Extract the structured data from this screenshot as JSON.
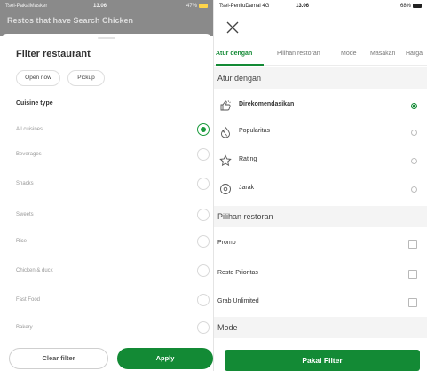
{
  "left": {
    "status": {
      "carrier": "Tsel-PakaiMasker",
      "time": "13.06",
      "battery": "47%"
    },
    "behind_title": "Restos that have Search Chicken",
    "title": "Filter restaurant",
    "chips": [
      "Open now",
      "Pickup"
    ],
    "section": "Cuisine type",
    "options": [
      {
        "label": "All cuisines",
        "selected": true
      },
      {
        "label": "Beverages",
        "selected": false
      },
      {
        "label": "Snacks",
        "selected": false
      },
      {
        "label": "Sweets",
        "selected": false
      },
      {
        "label": "Rice",
        "selected": false
      },
      {
        "label": "Chicken & duck",
        "selected": false
      },
      {
        "label": "Fast Food",
        "selected": false
      },
      {
        "label": "Bakery",
        "selected": false
      }
    ],
    "clear_label": "Clear filter",
    "apply_label": "Apply"
  },
  "right": {
    "status": {
      "carrier": "Tsel-PeniluDamai",
      "network": "4G",
      "time": "13.06",
      "battery": "68%"
    },
    "tabs": [
      "Atur dengan",
      "Pilihan restoran",
      "Mode",
      "Masakan",
      "Harga"
    ],
    "active_tab": 0,
    "sections": {
      "sort": "Atur dengan",
      "restaurant": "Pilihan restoran",
      "mode": "Mode"
    },
    "sort_options": [
      {
        "label": "Direkomendasikan",
        "icon": "thumbs-up-icon",
        "selected": true
      },
      {
        "label": "Popularitas",
        "icon": "fire-icon",
        "selected": false
      },
      {
        "label": "Rating",
        "icon": "star-icon",
        "selected": false
      },
      {
        "label": "Jarak",
        "icon": "location-pin-icon",
        "selected": false
      }
    ],
    "restaurant_options": [
      {
        "label": "Promo"
      },
      {
        "label": "Resto Prioritas"
      },
      {
        "label": "Grab Unlimited"
      }
    ],
    "apply_label": "Pakai Filter"
  },
  "colors": {
    "accent_green": "#138a35"
  }
}
